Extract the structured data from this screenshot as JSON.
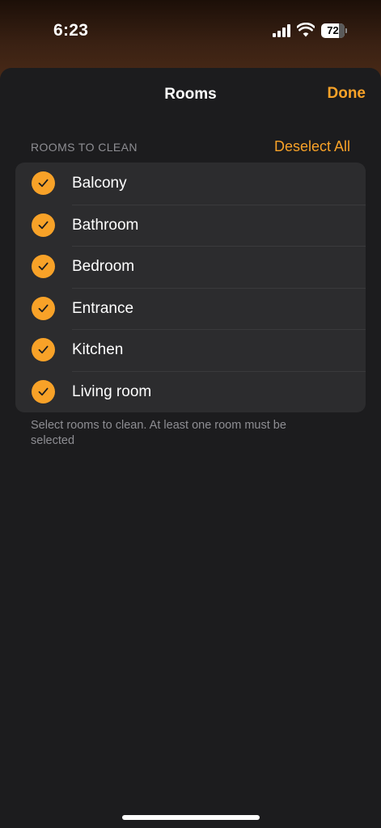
{
  "status_bar": {
    "time": "6:23",
    "battery_level": "72",
    "icons": [
      "cellular-signal-icon",
      "wifi-icon",
      "battery-icon"
    ]
  },
  "nav": {
    "title": "Rooms",
    "done_label": "Done"
  },
  "section": {
    "header": "ROOMS TO CLEAN",
    "deselect_label": "Deselect All"
  },
  "rooms": [
    {
      "label": "Balcony",
      "selected": true
    },
    {
      "label": "Bathroom",
      "selected": true
    },
    {
      "label": "Bedroom",
      "selected": true
    },
    {
      "label": "Entrance",
      "selected": true
    },
    {
      "label": "Kitchen",
      "selected": true
    },
    {
      "label": "Living room",
      "selected": true
    }
  ],
  "footer": {
    "note": "Select rooms to clean. At least one room must be selected"
  },
  "colors": {
    "accent": "#f8a228",
    "sheet_background": "#1c1c1e",
    "list_background": "#2c2c2e",
    "secondary_text": "#8e8e93"
  }
}
